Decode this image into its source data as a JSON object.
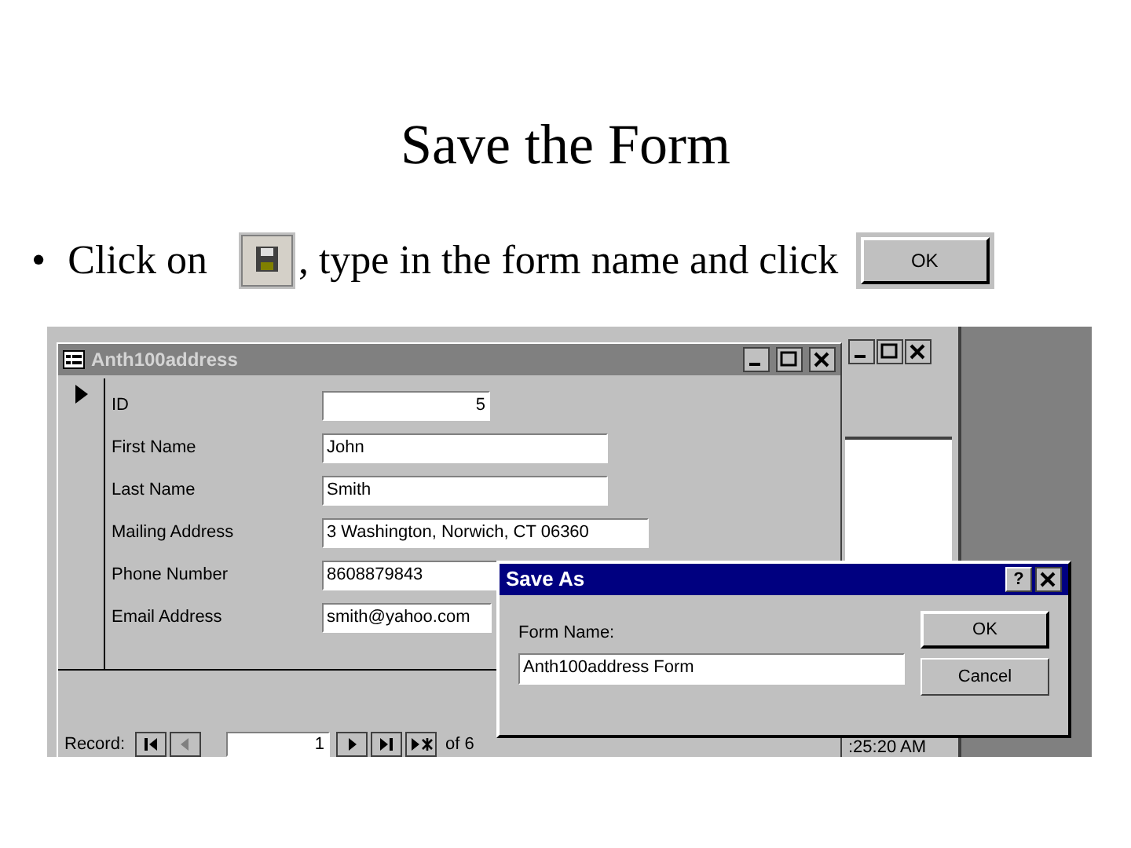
{
  "slide": {
    "title": "Save the Form",
    "bullet": {
      "marker": "•",
      "before": "Click on",
      "after": ", type in the form name and click",
      "ok_button": "OK"
    }
  },
  "background_window": {
    "status_time": ":25:20 AM"
  },
  "form_window": {
    "title": "Anth100address",
    "fields": [
      {
        "label": "ID",
        "value": "5",
        "kind": "number"
      },
      {
        "label": "First Name",
        "value": "John",
        "kind": "text"
      },
      {
        "label": "Last Name",
        "value": "Smith",
        "kind": "text"
      },
      {
        "label": "Mailing Address",
        "value": "3 Washington, Norwich, CT 06360",
        "kind": "text"
      },
      {
        "label": "Phone Number",
        "value": "8608879843",
        "kind": "text"
      },
      {
        "label": "Email Address",
        "value": "smith@yahoo.com",
        "kind": "text"
      }
    ],
    "record_nav": {
      "label": "Record:",
      "current": "1",
      "total": "of 6"
    }
  },
  "dialog": {
    "title": "Save As",
    "help": "?",
    "field_label": "Form Name:",
    "value": "Anth100address Form",
    "buttons": [
      "OK",
      "Cancel"
    ]
  }
}
